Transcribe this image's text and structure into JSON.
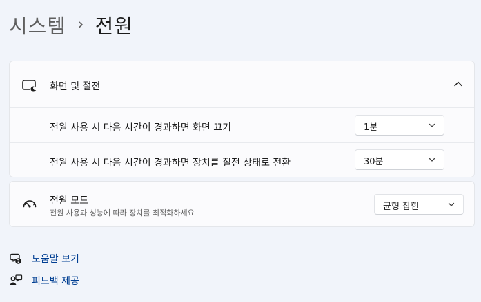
{
  "breadcrumb": {
    "parent": "시스템",
    "separator": "›",
    "current": "전원"
  },
  "display_sleep": {
    "title": "화면 및 절전",
    "icon": "screen-sleep-icon",
    "screen_off": {
      "label": "전원 사용 시 다음 시간이 경과하면 화면 끄기",
      "value": "1분"
    },
    "sleep": {
      "label": "전원 사용 시 다음 시간이 경과하면 장치를 절전 상태로 전환",
      "value": "30분"
    }
  },
  "power_mode": {
    "title": "전원 모드",
    "description": "전원 사용과 성능에 따라 장치를 최적화하세요",
    "icon": "speedometer-icon",
    "value": "균형 잡힌"
  },
  "links": {
    "help": "도움말 보기",
    "feedback": "피드백 제공"
  },
  "colors": {
    "background": "#f1f4fa",
    "card": "#fbfbfd",
    "link": "#003e92"
  }
}
